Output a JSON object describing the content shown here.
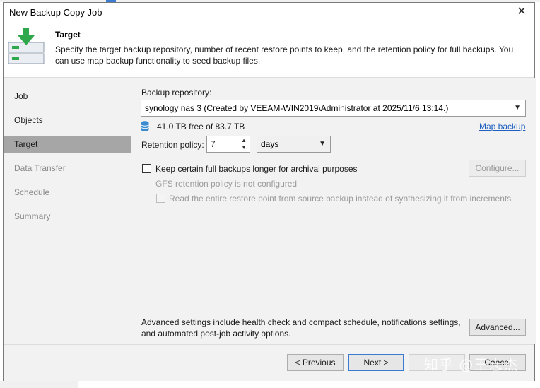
{
  "window": {
    "title": "New Backup Copy Job",
    "close_glyph": "✕"
  },
  "header": {
    "title": "Target",
    "description": "Specify the target backup repository, number of recent restore points to keep, and the retention policy for full backups. You can use map backup functionality to seed backup files.",
    "icon": "target-wizard-icon"
  },
  "sidebar": {
    "items": [
      {
        "label": "Job",
        "state": "normal"
      },
      {
        "label": "Objects",
        "state": "normal"
      },
      {
        "label": "Target",
        "state": "active"
      },
      {
        "label": "Data Transfer",
        "state": "disabled"
      },
      {
        "label": "Schedule",
        "state": "disabled"
      },
      {
        "label": "Summary",
        "state": "disabled"
      }
    ]
  },
  "main": {
    "repository_label": "Backup repository:",
    "repository_value": "synology nas 3 (Created by VEEAM-WIN2019\\Administrator at 2025/11/6 13:14.)",
    "storage_info": "41.0 TB free of 83.7 TB",
    "map_backup_link": "Map backup",
    "retention_label": "Retention policy:",
    "retention_value": "7",
    "retention_unit": "days",
    "keep_full_label": "Keep certain full backups longer for archival purposes",
    "configure_button": "Configure...",
    "gfs_status": "GFS retention policy is not configured",
    "read_entire_label": "Read the entire restore point from source backup instead of synthesizing it from increments",
    "advanced_text": "Advanced settings include health check and compact schedule, notifications settings, and automated post-job activity options.",
    "advanced_button": "Advanced..."
  },
  "footer": {
    "previous_button": "< Previous",
    "next_button": "Next >",
    "finish_button": "",
    "cancel_button": "Cancel"
  },
  "watermark": "知乎 @王志杰",
  "colors": {
    "accent": "#3d7bd0",
    "link": "#1f5fbf",
    "active_nav": "#a6a6a6",
    "panel": "#f2f2f2"
  }
}
